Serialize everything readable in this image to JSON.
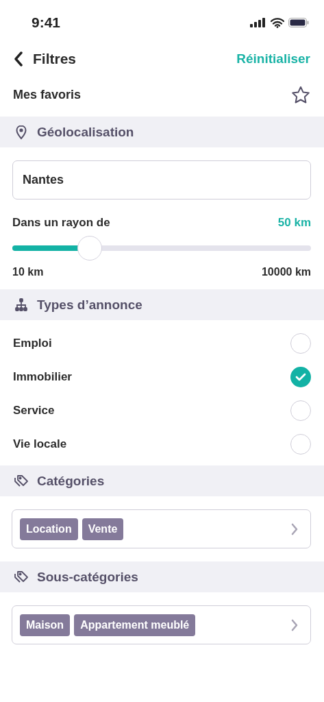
{
  "status_bar": {
    "time": "9:41"
  },
  "header": {
    "title": "Filtres",
    "action": "Réinitialiser"
  },
  "favorites": {
    "label": "Mes favoris",
    "starred": false
  },
  "sections": [
    {
      "title": "Géolocalisation",
      "kind": "geolocation",
      "city_field": {
        "value": "Nantes"
      },
      "radius": {
        "label": "Dans un rayon de",
        "value": "50 km",
        "level": 0.26,
        "min": "10 km",
        "max": "10000 km"
      }
    },
    {
      "title": "Types d’annonce",
      "kind": "ad_types",
      "options": [
        {
          "label": "Emploi",
          "checked": false
        },
        {
          "label": "Immobilier",
          "checked": true
        },
        {
          "label": "Service",
          "checked": false
        },
        {
          "label": "Vie locale",
          "checked": false
        }
      ]
    },
    {
      "title": "Catégories",
      "kind": "categories",
      "chips": [
        "Location",
        "Vente"
      ]
    },
    {
      "title": "Sous-catégories",
      "kind": "subcategories",
      "chips": [
        "Maison",
        "Appartement meublé"
      ]
    }
  ]
}
